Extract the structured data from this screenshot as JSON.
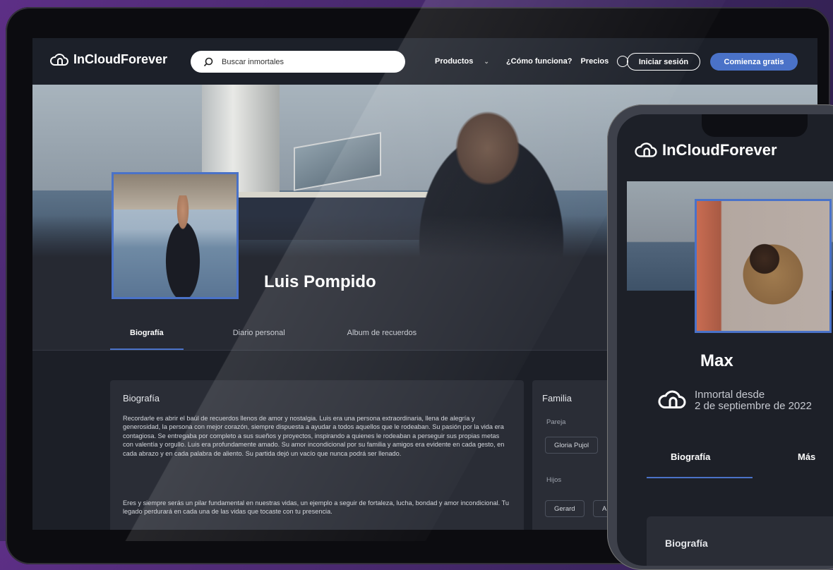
{
  "brand": "InCloudForever",
  "search": {
    "placeholder": "Buscar inmortales"
  },
  "nav": {
    "products": "Productos",
    "how": "¿Cómo funciona?",
    "prices": "Precios",
    "login": "Iniciar sesión",
    "start": "Comienza gratis"
  },
  "profile": {
    "name": "Luis Pompido"
  },
  "tabs": [
    "Biografía",
    "Diario personal",
    "Album de recuerdos"
  ],
  "biography": {
    "title": "Biografía",
    "p1": "Recordarle es abrir el baúl de recuerdos llenos de amor y nostalgia. Luis era una persona extraordinaria, llena de alegría y generosidad, la persona con mejor corazón, siempre dispuesta a ayudar a todos aquellos que le rodeaban. Su pasión por la vida era contagiosa. Se entregaba por completo a sus sueños y proyectos, inspirando a quienes le rodeaban a perseguir sus propias metas con valentía y orgullo. Luis era profundamente amado. Su amor incondicional por su familia y amigos era evidente en cada gesto, en cada abrazo y en cada palabra de aliento. Su partida dejó un vacío que nunca podrá ser llenado.",
    "p2": "Eres y siempre serás un pilar fundamental en nuestras vidas, un ejemplo a seguir de fortaleza, lucha, bondad y amor incondicional. Tu legado perdurará en cada una de las vidas que tocaste con tu presencia."
  },
  "family": {
    "title": "Familia",
    "partner_label": "Pareja",
    "partner": "Gloria Pujol",
    "children_label": "Hijos",
    "child1": "Gerard",
    "child2": "Alb"
  },
  "phone": {
    "brand": "InCloudForever",
    "name": "Max",
    "since_line1": "Inmortal desde",
    "since_line2": "2 de septiembre de 2022",
    "tab_bio": "Biografía",
    "tab_more": "Más",
    "card_title": "Biografía"
  },
  "colors": {
    "accent": "#4a72c8",
    "nav": "#1c2029",
    "card": "#2a2d36"
  }
}
